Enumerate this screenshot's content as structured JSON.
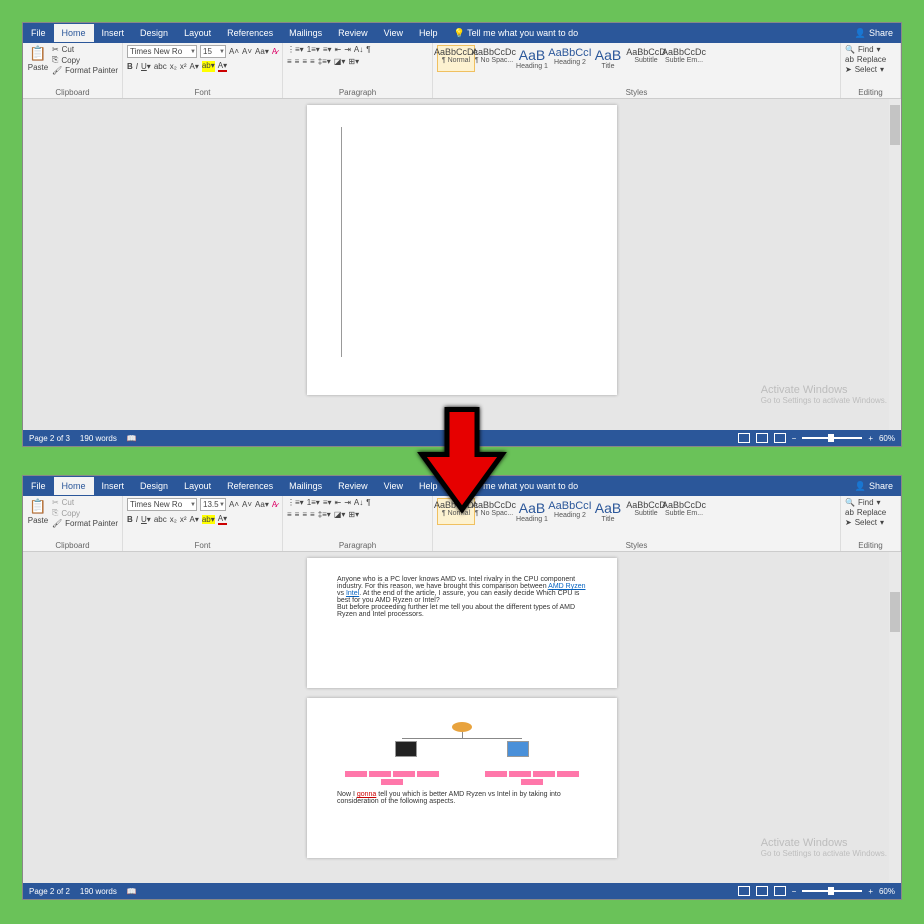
{
  "tabs": [
    "File",
    "Home",
    "Insert",
    "Design",
    "Layout",
    "References",
    "Mailings",
    "Review",
    "View",
    "Help"
  ],
  "active_tab": "Home",
  "tell_me": "Tell me what you want to do",
  "share": "Share",
  "clipboard": {
    "paste": "Paste",
    "cut": "Cut",
    "copy": "Copy",
    "format_painter": "Format Painter",
    "label": "Clipboard"
  },
  "font": {
    "name": "Times New Ro",
    "size_top": "15",
    "size_bottom": "13.5",
    "label": "Font"
  },
  "paragraph": {
    "label": "Paragraph"
  },
  "styles": {
    "label": "Styles",
    "items": [
      {
        "sample": "AaBbCcDc",
        "name": "¶ Normal"
      },
      {
        "sample": "AaBbCcDc",
        "name": "¶ No Spac..."
      },
      {
        "sample": "AaB",
        "name": "Heading 1",
        "big": true
      },
      {
        "sample": "AaBbCcI",
        "name": "Heading 2",
        "mid": true
      },
      {
        "sample": "AaB",
        "name": "Title",
        "big": true
      },
      {
        "sample": "AaBbCcD",
        "name": "Subtitle"
      },
      {
        "sample": "AaBbCcDc",
        "name": "Subtle Em..."
      }
    ]
  },
  "editing": {
    "find": "Find",
    "replace": "Replace",
    "select": "Select",
    "label": "Editing"
  },
  "status_top": {
    "page": "Page 2 of 3",
    "words": "190 words",
    "zoom": "60%"
  },
  "status_bottom": {
    "page": "Page 2 of 2",
    "words": "190 words",
    "zoom": "60%"
  },
  "watermark": {
    "title": "Activate Windows",
    "sub": "Go to Settings to activate Windows."
  },
  "doc_text": {
    "p1": "Anyone who is a PC lover knows AMD vs. Intel rivalry in the CPU component industry. For this reason, we have brought this comparison between ",
    "link1": "AMD Ryzen",
    "mid": " vs ",
    "link2": "Intel",
    "p1b": ". At the end of the article, I assure, you can easily decide Which CPU is best for you AMD Ryzen or Intel?",
    "p2": "But before proceeding further let me tell you about the different types of AMD Ryzen and Intel processors.",
    "p3a": "Now I ",
    "link3": "gonna",
    "p3b": " tell you which is better AMD Ryzen vs Intel in by taking into consideration of the following aspects."
  }
}
